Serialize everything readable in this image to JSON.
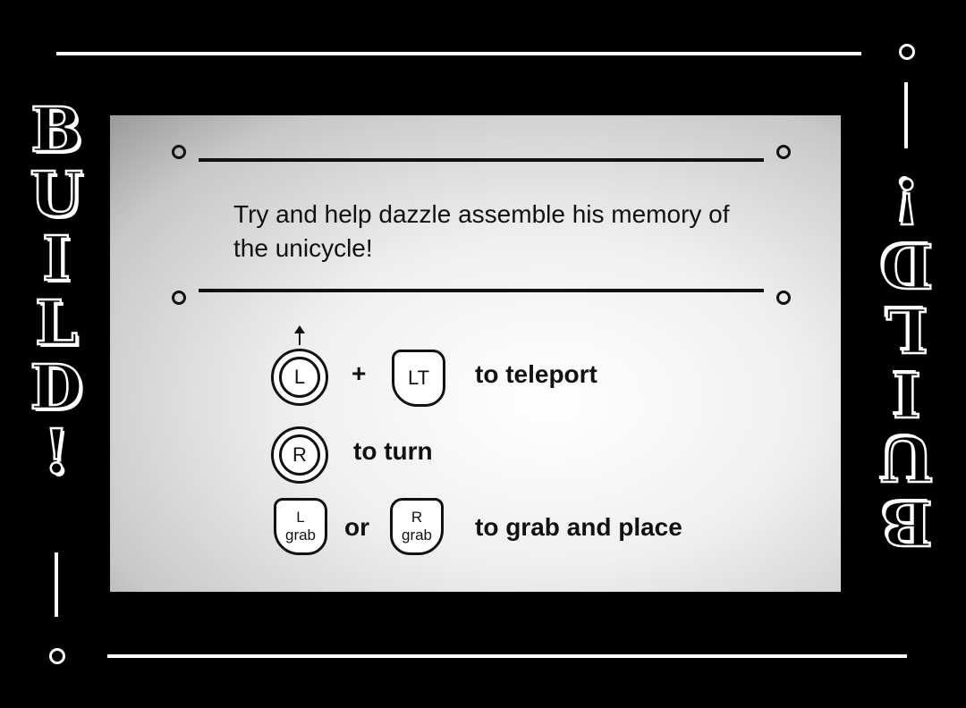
{
  "title_left": [
    "B",
    "U",
    "I",
    "L",
    "D",
    "!"
  ],
  "title_right": [
    "B",
    "U",
    "I",
    "L",
    "D",
    "!"
  ],
  "message": "Try and help dazzle assemble his memory of the unicycle!",
  "controls": {
    "teleport": {
      "stick_label": "L",
      "plus": "+",
      "trigger_label": "LT",
      "action": "to teleport"
    },
    "turn": {
      "stick_label": "R",
      "action": "to turn"
    },
    "grab": {
      "left_label_top": "L",
      "left_label_bottom": "grab",
      "or": "or",
      "right_label_top": "R",
      "right_label_bottom": "grab",
      "action": "to grab and place"
    }
  },
  "colors": {
    "background": "#000000",
    "ornament": "#ffffff",
    "panel_center": "#ffffff",
    "panel_edge": "#9a9a9a",
    "text": "#111111"
  }
}
